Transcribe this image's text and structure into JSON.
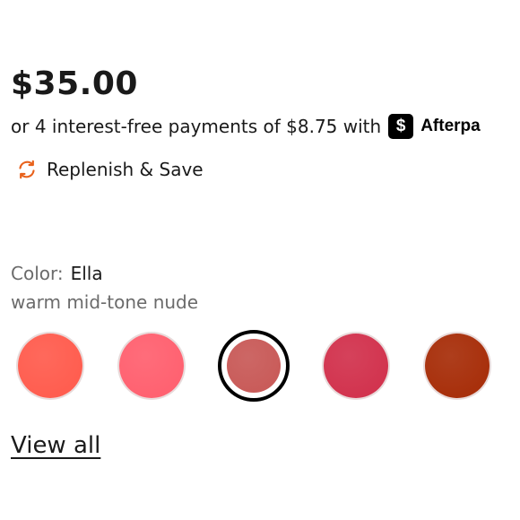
{
  "product": {
    "price": "$35.00",
    "payments_text": "or 4 interest-free payments of $8.75 with",
    "afterpay_badge_glyph": "$",
    "afterpay_brand": "Afterpa",
    "replenish_label": "Replenish & Save",
    "replenish_icon": "refresh-icon",
    "replenish_icon_color": "#e8621c"
  },
  "color": {
    "prefix": "Color:",
    "selected_name": "Ella",
    "description": "warm mid-tone nude",
    "swatches": [
      {
        "color": "#ff5e50",
        "selected": false
      },
      {
        "color": "#ff6271",
        "selected": false
      },
      {
        "color": "#c95c5a",
        "selected": true
      },
      {
        "color": "#d2344f",
        "selected": false
      },
      {
        "color": "#a8300c",
        "selected": false
      }
    ]
  },
  "links": {
    "view_all": "View all"
  }
}
